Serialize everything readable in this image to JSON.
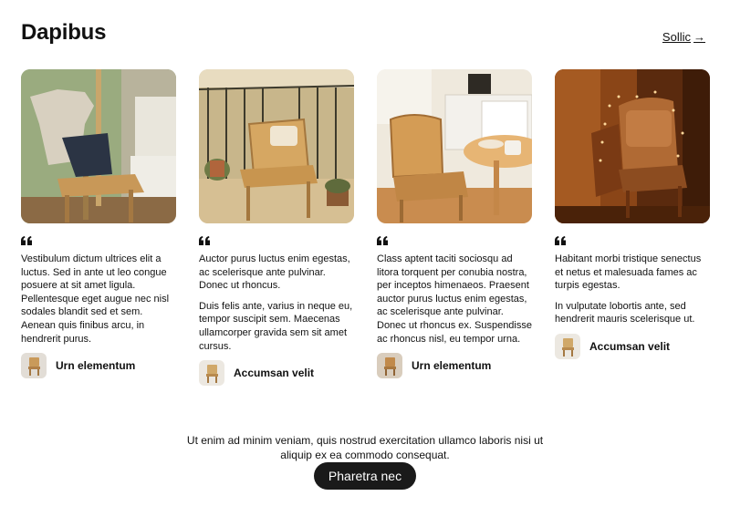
{
  "header": {
    "title": "Dapibus",
    "link_label": "Sollic",
    "link_arrow": "→"
  },
  "testimonials": [
    {
      "image_icon": "chair-with-clothes-photo",
      "paragraphs": [
        "Vestibulum dictum ultrices elit a luctus. Sed in ante ut leo congue posuere at sit amet ligula. Pellentesque eget augue nec nisl sodales blandit sed et sem. Aenean quis finibus arcu, in hendrerit purus."
      ],
      "author": "Urn elementum"
    },
    {
      "image_icon": "balcony-chair-photo",
      "paragraphs": [
        "Auctor purus luctus enim egestas, ac scelerisque ante pulvinar. Donec ut rhoncus.",
        "Duis felis ante, varius in neque eu, tempor suscipit sem. Maecenas ullamcorper gravida sem sit amet cursus."
      ],
      "author": "Accumsan velit"
    },
    {
      "image_icon": "kitchen-chair-photo",
      "paragraphs": [
        "Class aptent taciti sociosqu ad litora torquent per conubia nostra, per inceptos himenaeos. Praesent auctor purus luctus enim egestas, ac scelerisque ante pulvinar. Donec ut rhoncus ex. Suspendisse ac rhoncus nisl, eu tempor urna."
      ],
      "author": "Urn elementum"
    },
    {
      "image_icon": "chair-fairy-lights-photo",
      "paragraphs": [
        "Habitant morbi tristique senectus et netus et malesuada fames ac turpis egestas.",
        "In vulputate lobortis ante, sed hendrerit mauris scelerisque ut."
      ],
      "author": "Accumsan velit"
    }
  ],
  "footer": {
    "text": "Ut enim ad minim veniam, quis nostrud exercitation ullamco laboris nisi ut aliquip ex ea commodo consequat.",
    "button_label": "Pharetra nec"
  },
  "colors": {
    "button_bg": "#1a1a1a",
    "text": "#111111",
    "background": "#ffffff"
  }
}
